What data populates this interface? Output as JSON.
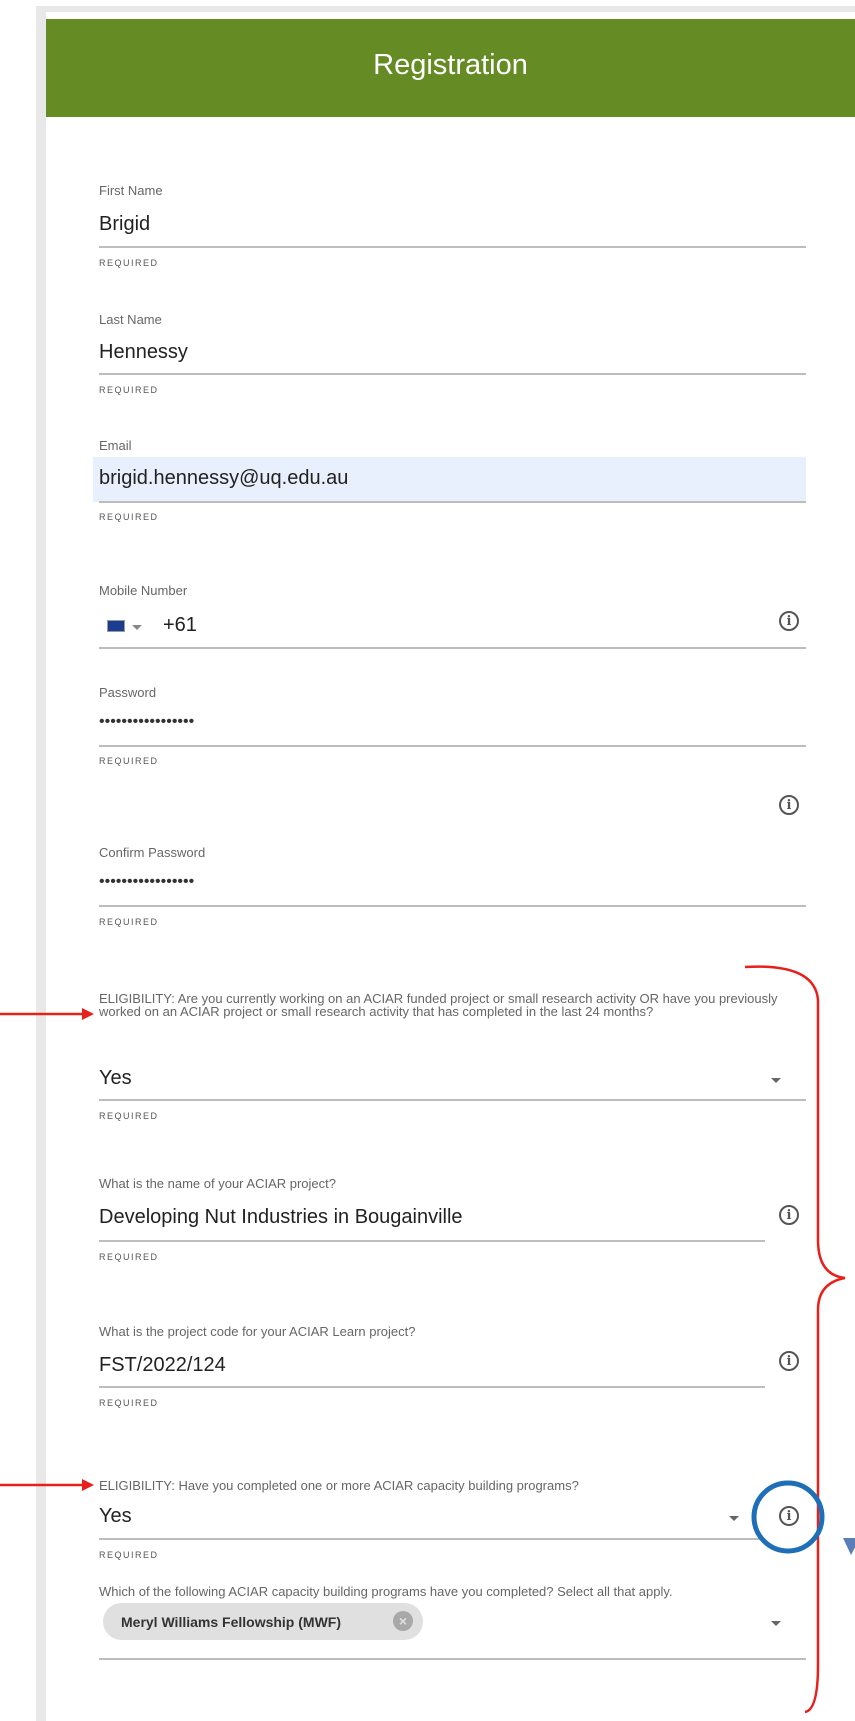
{
  "header": {
    "title": "Registration"
  },
  "fields": {
    "first_name": {
      "label": "First Name",
      "value": "Brigid",
      "required": "REQUIRED"
    },
    "last_name": {
      "label": "Last Name",
      "value": "Hennessy",
      "required": "REQUIRED"
    },
    "email": {
      "label": "Email",
      "value": "brigid.hennessy@uq.edu.au",
      "required": "REQUIRED"
    },
    "mobile": {
      "label": "Mobile Number",
      "code": "+61"
    },
    "password": {
      "label": "Password",
      "value": "•••••••••••••••••",
      "required": "REQUIRED"
    },
    "confirm_password": {
      "label": "Confirm Password",
      "value": "•••••••••••••••••",
      "required": "REQUIRED"
    },
    "eligibility_1": {
      "label": "ELIGIBILITY: Are you currently working on an ACIAR funded project or small research activity OR have you previously worked on an ACIAR project or small research activity that has completed in the last 24 months?",
      "value": "Yes",
      "required": "REQUIRED"
    },
    "project_name": {
      "label": "What is the name of your ACIAR project?",
      "value": "Developing Nut Industries in Bougainville",
      "required": "REQUIRED"
    },
    "project_code": {
      "label": "What is the project code for your ACIAR Learn project?",
      "value": "FST/2022/124",
      "required": "REQUIRED"
    },
    "eligibility_2": {
      "label": "ELIGIBILITY: Have you completed one or more ACIAR capacity building programs?",
      "value": "Yes",
      "required": "REQUIRED"
    },
    "programs": {
      "label": "Which of the following ACIAR capacity building programs have you completed? Select all that apply.",
      "chips": [
        "Meryl Williams Fellowship (MWF)"
      ]
    }
  },
  "annotation_colors": {
    "arrow": "#e8201c",
    "bracket": "#e8201c",
    "circle": "#1f6fb8",
    "header": "#658b24"
  }
}
